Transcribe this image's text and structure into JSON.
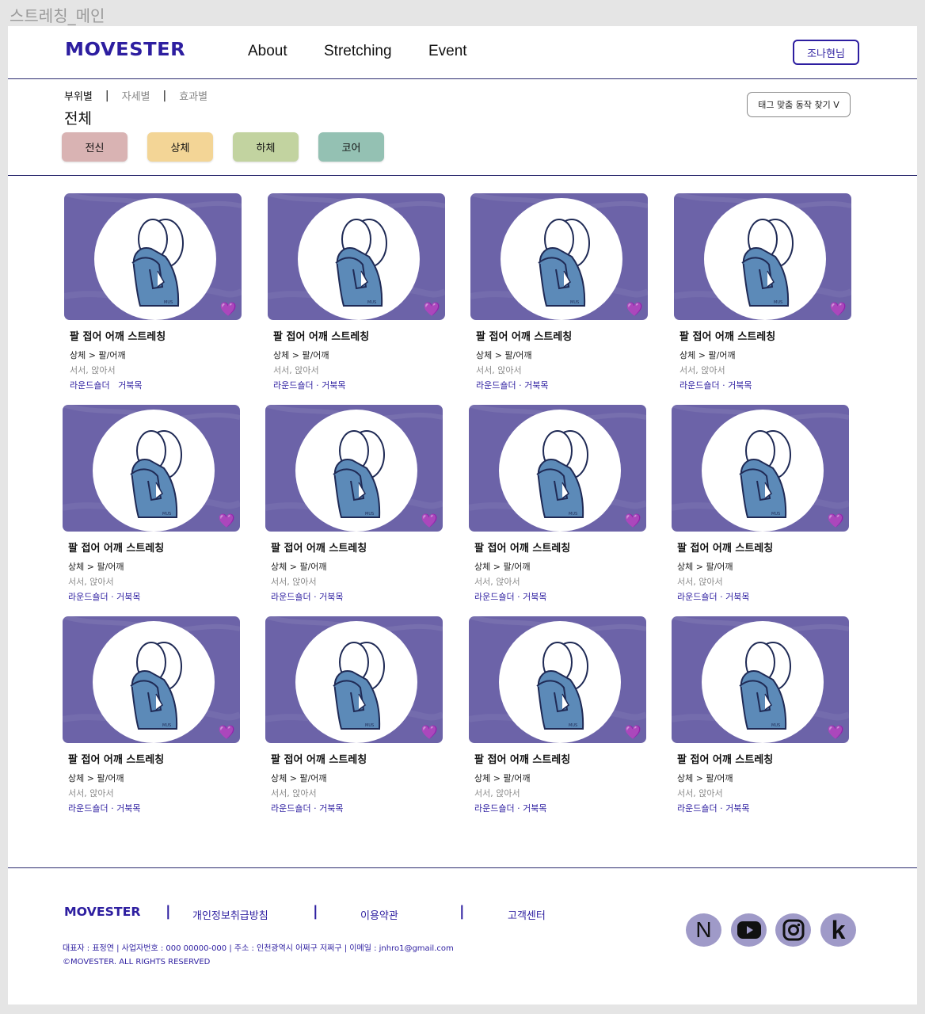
{
  "frame_title": "스트레칭_메인",
  "header": {
    "logo": "MOVESTER",
    "nav": [
      "About",
      "Stretching",
      "Event"
    ],
    "user_button": "조나현님"
  },
  "filter": {
    "tabs": [
      {
        "label": "부위별",
        "active": true
      },
      {
        "label": "자세별",
        "active": false
      },
      {
        "label": "효과별",
        "active": false
      }
    ],
    "tab_separator": "|",
    "selected_title": "전체",
    "chips": [
      {
        "label": "전신",
        "color": "#d9b3b3"
      },
      {
        "label": "상체",
        "color": "#f3d596"
      },
      {
        "label": "하체",
        "color": "#c2d3a0"
      },
      {
        "label": "코어",
        "color": "#94c1b3"
      }
    ],
    "tag_search_button": "태그 맞춤 동작 찾기 V"
  },
  "card_colors": {
    "thumb_bg": "#6c63a8",
    "figure": "#5c8ab8",
    "heart": "#a94bf0"
  },
  "cards": [
    {
      "title": "팔 접어 어깨 스트레칭",
      "category": "상체 > 팔/어깨",
      "pose": "서서, 앉아서",
      "tags": "라운드숄더   거북목",
      "favorite": "💜"
    },
    {
      "title": "팔 접어 어깨 스트레칭",
      "category": "상체 > 팔/어깨",
      "pose": "서서, 앉아서",
      "tags": "라운드숄더 · 거북목",
      "favorite": "💜"
    },
    {
      "title": "팔 접어 어깨 스트레칭",
      "category": "상체 > 팔/어깨",
      "pose": "서서, 앉아서",
      "tags": "라운드숄더 · 거북목",
      "favorite": "💜"
    },
    {
      "title": "팔 접어 어깨 스트레칭",
      "category": "상체 > 팔/어깨",
      "pose": "서서, 앉아서",
      "tags": "라운드숄더 · 거북목",
      "favorite": "💜"
    },
    {
      "title": "팔 접어 어깨 스트레칭",
      "category": "상체 > 팔/어깨",
      "pose": "서서, 앉아서",
      "tags": "라운드숄더 · 거북목",
      "favorite": "💜"
    },
    {
      "title": "팔 접어 어깨 스트레칭",
      "category": "상체 > 팔/어깨",
      "pose": "서서, 앉아서",
      "tags": "라운드숄더 · 거북목",
      "favorite": "💜"
    },
    {
      "title": "팔 접어 어깨 스트레칭",
      "category": "상체 > 팔/어깨",
      "pose": "서서, 앉아서",
      "tags": "라운드숄더 · 거북목",
      "favorite": "💜"
    },
    {
      "title": "팔 접어 어깨 스트레칭",
      "category": "상체 > 팔/어깨",
      "pose": "서서, 앉아서",
      "tags": "라운드숄더 · 거북목",
      "favorite": "💜"
    },
    {
      "title": "팔 접어 어깨 스트레칭",
      "category": "상체 > 팔/어깨",
      "pose": "서서, 앉아서",
      "tags": "라운드숄더 · 거북목",
      "favorite": "💜"
    },
    {
      "title": "팔 접어 어깨 스트레칭",
      "category": "상체 > 팔/어깨",
      "pose": "서서, 앉아서",
      "tags": "라운드숄더 · 거북목",
      "favorite": "💜"
    },
    {
      "title": "팔 접어 어깨 스트레칭",
      "category": "상체 > 팔/어깨",
      "pose": "서서, 앉아서",
      "tags": "라운드숄더 · 거북목",
      "favorite": "💜"
    },
    {
      "title": "팔 접어 어깨 스트레칭",
      "category": "상체 > 팔/어깨",
      "pose": "서서, 앉아서",
      "tags": "라운드숄더 · 거북목",
      "favorite": "💜"
    }
  ],
  "footer": {
    "logo": "MOVESTER",
    "separator": "|",
    "links": [
      "개인정보취급방침",
      "이용약관",
      "고객센터"
    ],
    "info": "대표자 : 표정연   |   사업자번호 : 000 00000-000  |   주소 : 인천광역시 어쩌구 저쩌구   |   이메일 : jnhro1@gmail.com",
    "copyright": "©MOVESTER. ALL RIGHTS RESERVED",
    "social": [
      {
        "icon": "naver-icon",
        "glyph": "N"
      },
      {
        "icon": "youtube-icon",
        "glyph": ""
      },
      {
        "icon": "instagram-icon",
        "glyph": ""
      },
      {
        "icon": "kakao-icon",
        "glyph": "k"
      }
    ]
  }
}
